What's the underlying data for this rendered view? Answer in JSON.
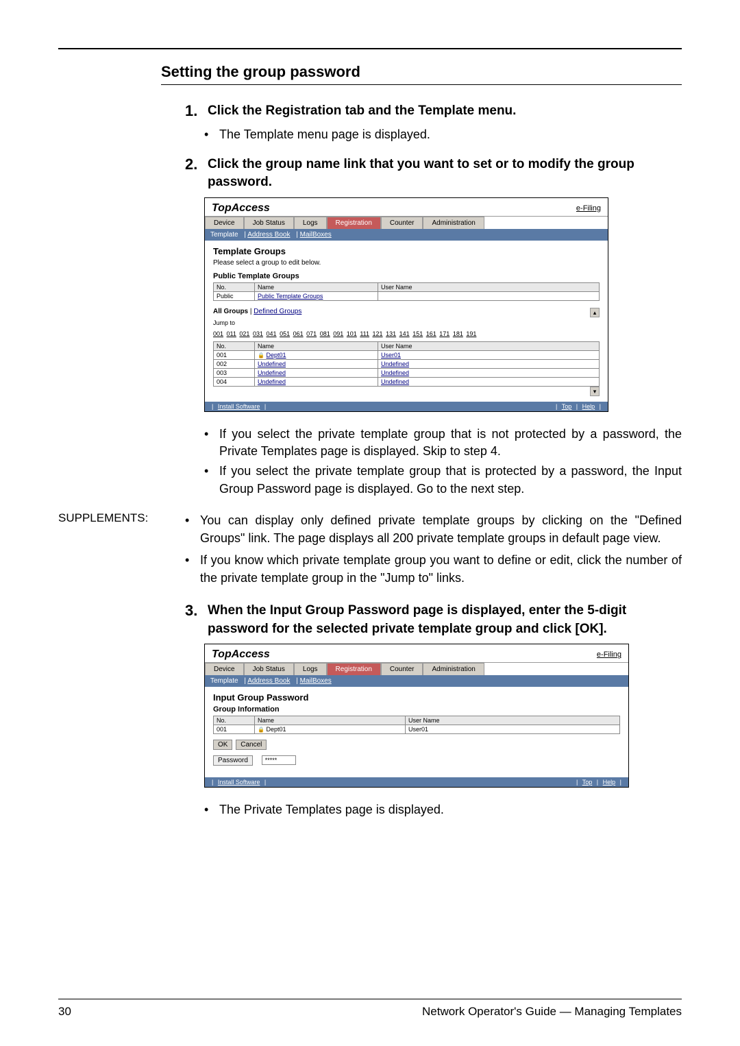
{
  "section_title": "Setting the group password",
  "step1_text": "Click the Registration tab and the Template menu.",
  "step1_bullet": "The Template menu page is displayed.",
  "step2_text": "Click the group name link that you want to set or to modify the group password.",
  "screenshot1": {
    "logo": "TopAccess",
    "efiling": "e-Filing",
    "tabs": {
      "device": "Device",
      "job_status": "Job Status",
      "logs": "Logs",
      "registration": "Registration",
      "counter": "Counter",
      "administration": "Administration"
    },
    "submenu": {
      "template": "Template",
      "address_book": "Address Book",
      "mailboxes": "MailBoxes"
    },
    "h2": "Template Groups",
    "p": "Please select a group to edit below.",
    "h3": "Public Template Groups",
    "th_no": "No.",
    "th_name": "Name",
    "th_user": "User Name",
    "row_public_no": "Public",
    "row_public_name": "Public Template Groups",
    "allgroups": "All Groups",
    "defined_groups": "Defined Groups",
    "jumpto": "Jump to",
    "jump_links": [
      "001",
      "011",
      "021",
      "031",
      "041",
      "051",
      "061",
      "071",
      "081",
      "091",
      "101",
      "111",
      "121",
      "131",
      "141",
      "151",
      "161",
      "171",
      "181",
      "191"
    ],
    "rows": [
      {
        "no": "001",
        "name": "Dept01",
        "user": "User01",
        "lock": true
      },
      {
        "no": "002",
        "name": "Undefined",
        "user": "Undefined",
        "lock": false
      },
      {
        "no": "003",
        "name": "Undefined",
        "user": "Undefined",
        "lock": false
      },
      {
        "no": "004",
        "name": "Undefined",
        "user": "Undefined",
        "lock": false
      }
    ],
    "install_software": "Install Software",
    "top": "Top",
    "help": "Help"
  },
  "post_ss1_bullets": [
    "If you select the private template group that is not protected by a password, the Private Templates page is displayed.  Skip to step 4.",
    "If you select the private template group that is protected by a password, the Input Group Password page is displayed.  Go to the next step."
  ],
  "supplements_label": "SUPPLEMENTS:",
  "supplements": [
    "You can display only defined private template groups by clicking on the \"Defined Groups\" link.  The page displays all 200 private template groups in default page view.",
    "If you know which private template group you want to define or edit, click the number of the private template group in the  \"Jump to\" links."
  ],
  "step3_text": "When the Input Group Password page is displayed, enter the 5-digit password for the selected private template group and click [OK].",
  "screenshot2": {
    "logo": "TopAccess",
    "efiling": "e-Filing",
    "tabs": {
      "device": "Device",
      "job_status": "Job Status",
      "logs": "Logs",
      "registration": "Registration",
      "counter": "Counter",
      "administration": "Administration"
    },
    "submenu": {
      "template": "Template",
      "address_book": "Address Book",
      "mailboxes": "MailBoxes"
    },
    "h2": "Input Group Password",
    "h3": "Group Information",
    "th_no": "No.",
    "th_name": "Name",
    "th_user": "User Name",
    "row_no": "001",
    "row_name": "Dept01",
    "row_user": "User01",
    "ok": "OK",
    "cancel": "Cancel",
    "password_label": "Password",
    "password_value": "*****",
    "install_software": "Install Software",
    "top": "Top",
    "help": "Help"
  },
  "post_ss2_bullet": "The Private Templates page is displayed.",
  "page_number": "30",
  "footer_text": "Network Operator's Guide — Managing Templates"
}
